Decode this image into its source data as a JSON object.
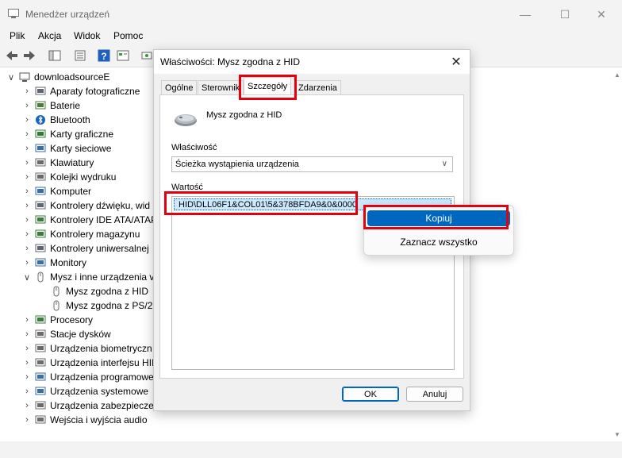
{
  "app": {
    "title": "Menedżer urządzeń",
    "menu": [
      "Plik",
      "Akcja",
      "Widok",
      "Pomoc"
    ],
    "toolbar_icons": [
      "back-arrow-icon",
      "forward-arrow-icon",
      "properties-icon",
      "console-tree-icon",
      "help-icon",
      "view-icon",
      "scan-icon"
    ]
  },
  "tree": {
    "root": "downloadsourceE",
    "items": [
      {
        "label": "Aparaty fotograficzne",
        "icon": "camera-icon",
        "expanded": false
      },
      {
        "label": "Baterie",
        "icon": "battery-icon",
        "expanded": false
      },
      {
        "label": "Bluetooth",
        "icon": "bluetooth-icon",
        "expanded": false
      },
      {
        "label": "Karty graficzne",
        "icon": "display-adapter-icon",
        "expanded": false
      },
      {
        "label": "Karty sieciowe",
        "icon": "network-adapter-icon",
        "expanded": false
      },
      {
        "label": "Klawiatury",
        "icon": "keyboard-icon",
        "expanded": false
      },
      {
        "label": "Kolejki wydruku",
        "icon": "printer-icon",
        "expanded": false
      },
      {
        "label": "Komputer",
        "icon": "computer-icon",
        "expanded": false
      },
      {
        "label": "Kontrolery dźwięku, wid",
        "icon": "sound-icon",
        "expanded": false
      },
      {
        "label": "Kontrolery IDE ATA/ATAP",
        "icon": "ide-controller-icon",
        "expanded": false
      },
      {
        "label": "Kontrolery magazynu",
        "icon": "storage-controller-icon",
        "expanded": false
      },
      {
        "label": "Kontrolery uniwersalnej",
        "icon": "usb-controller-icon",
        "expanded": false
      },
      {
        "label": "Monitory",
        "icon": "monitor-icon",
        "expanded": false
      },
      {
        "label": "Mysz i inne urządzenia v",
        "icon": "mouse-icon",
        "expanded": true
      },
      {
        "label": "Mysz zgodna z HID",
        "icon": "mouse-icon",
        "child": true
      },
      {
        "label": "Mysz zgodna z PS/2",
        "icon": "mouse-icon",
        "child": true
      },
      {
        "label": "Procesory",
        "icon": "processor-icon",
        "expanded": false
      },
      {
        "label": "Stacje dysków",
        "icon": "disk-drive-icon",
        "expanded": false
      },
      {
        "label": "Urządzenia biometryczn",
        "icon": "biometric-icon",
        "expanded": false
      },
      {
        "label": "Urządzenia interfejsu HII",
        "icon": "hid-icon",
        "expanded": false
      },
      {
        "label": "Urządzenia programowe",
        "icon": "software-device-icon",
        "expanded": false
      },
      {
        "label": "Urządzenia systemowe",
        "icon": "system-device-icon",
        "expanded": false
      },
      {
        "label": "Urządzenia zabezpieczer",
        "icon": "security-device-icon",
        "expanded": false
      },
      {
        "label": "Wejścia i wyjścia audio",
        "icon": "audio-io-icon",
        "expanded": false
      }
    ]
  },
  "dialog": {
    "title": "Właściwości: Mysz zgodna z HID",
    "tabs": [
      "Ogólne",
      "Sterownik",
      "Szczegóły",
      "Zdarzenia"
    ],
    "active_tab": "Szczegóły",
    "device_name": "Mysz zgodna z HID",
    "property_label": "Właściwość",
    "property_value": "Ścieżka wystąpienia urządzenia",
    "value_label": "Wartość",
    "value_item": "HID\\DLL06F1&COL01\\5&378BFDA9&0&0000",
    "ok_label": "OK",
    "cancel_label": "Anuluj"
  },
  "context_menu": {
    "items": [
      "Kopiuj",
      "Zaznacz wszystko"
    ],
    "selected": "Kopiuj"
  },
  "colors": {
    "highlight": "#e3000f",
    "selection": "#0067c0",
    "value_selection": "#cce8ff"
  }
}
